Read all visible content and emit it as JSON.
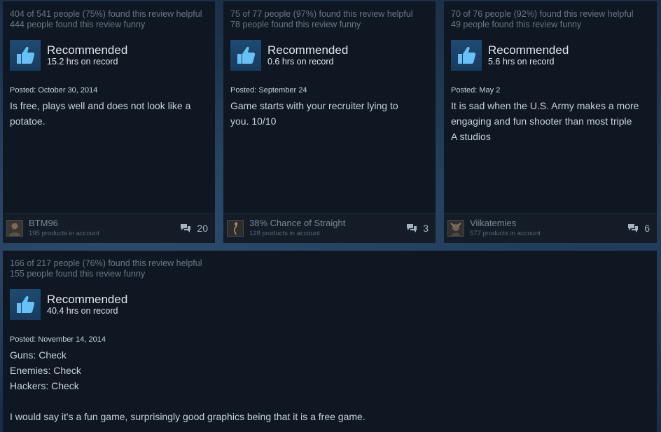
{
  "reviews": [
    {
      "helpful": "404 of 541 people (75%) found this review helpful",
      "funny": "444 people found this review funny",
      "recommendation": "Recommended",
      "hours": "15.2 hrs on record",
      "posted": "Posted: October 30, 2014",
      "body": [
        "Is free, plays well and does not look like a",
        "potatoe."
      ],
      "author": "BTM96",
      "products": "195 products in account",
      "comments": "20"
    },
    {
      "helpful": "75 of 77 people (97%) found this review helpful",
      "funny": "78 people found this review funny",
      "recommendation": "Recommended",
      "hours": "0.6 hrs on record",
      "posted": "Posted: September 24",
      "body": [
        "Game starts with your recruiter lying to",
        "you. 10/10"
      ],
      "author": "38% Chance of Straight",
      "products": "128 products in account",
      "comments": "3"
    },
    {
      "helpful": "70 of 76 people (92%) found this review helpful",
      "funny": "49 people found this review funny",
      "recommendation": "Recommended",
      "hours": "5.6 hrs on record",
      "posted": "Posted: May 2",
      "body": [
        "It is sad when the U.S. Army makes a more",
        "engaging and fun shooter than most triple",
        "A studios"
      ],
      "author": "Viikatemies",
      "products": "577 products in account",
      "comments": "6"
    },
    {
      "helpful": "166 of 217 people (76%) found this review helpful",
      "funny": "155 people found this review funny",
      "recommendation": "Recommended",
      "hours": "40.4 hrs on record",
      "posted": "Posted: November 14, 2014",
      "body": [
        "Guns: Check",
        "Enemies: Check",
        "Hackers: Check",
        "",
        "I would say it's a fun game, surprisingly good graphics being that it is a free game."
      ]
    }
  ],
  "icons": {
    "thumb": "thumbs-up-icon",
    "comment": "comment-bubbles-icon"
  },
  "colors": {
    "card_bg": "#0f1722",
    "thumb_blue": "#67c1f5",
    "page_bg": "#1c3550"
  }
}
